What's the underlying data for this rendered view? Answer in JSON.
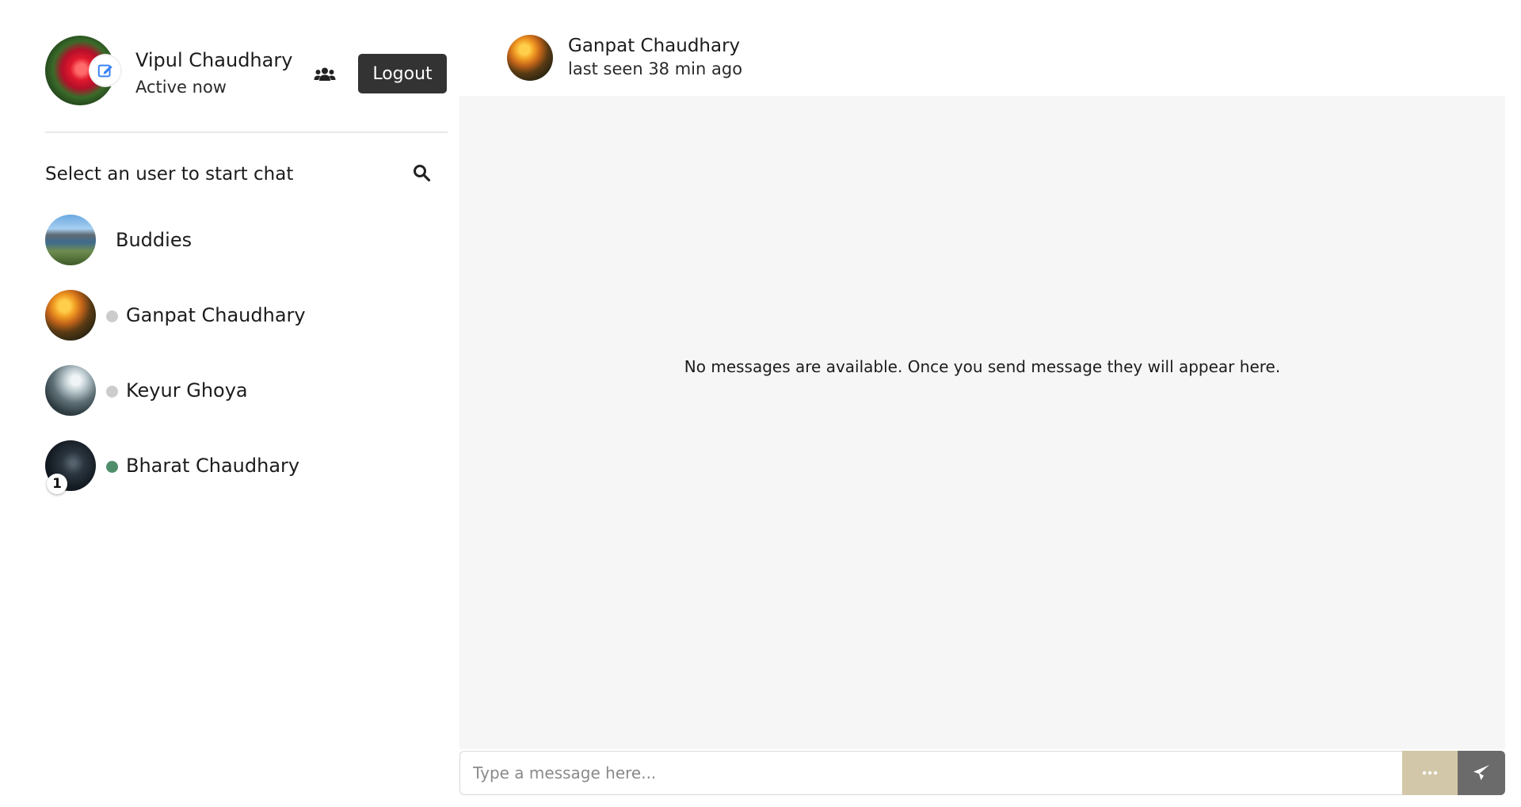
{
  "current_user": {
    "name": "Vipul Chaudhary",
    "status": "Active now",
    "avatar_icon": "edit-icon"
  },
  "header": {
    "logout_label": "Logout",
    "group_icon": "users-icon"
  },
  "sidebar": {
    "prompt": "Select an user to start chat",
    "search_icon": "search-icon",
    "contacts": [
      {
        "name": "Buddies",
        "type": "group"
      },
      {
        "name": "Ganpat Chaudhary",
        "online": false
      },
      {
        "name": "Keyur Ghoya",
        "online": false
      },
      {
        "name": "Bharat Chaudhary",
        "online": true,
        "unread": "1"
      }
    ]
  },
  "chat": {
    "peer_name": "Ganpat Chaudhary",
    "peer_last_seen": "last seen 38 min ago",
    "empty_message": "No messages are available. Once you send message they will appear here.",
    "input_placeholder": "Type a message here...",
    "more_icon": "ellipsis-icon",
    "send_icon": "paper-plane-icon"
  },
  "colors": {
    "logout_bg": "#333333",
    "online": "#4f8e6b",
    "offline": "#cccccc",
    "more_button": "#d2c7a8",
    "send_button": "#6b6b6b",
    "chat_background": "#f6f6f6",
    "edit_icon": "#3b82f6"
  }
}
